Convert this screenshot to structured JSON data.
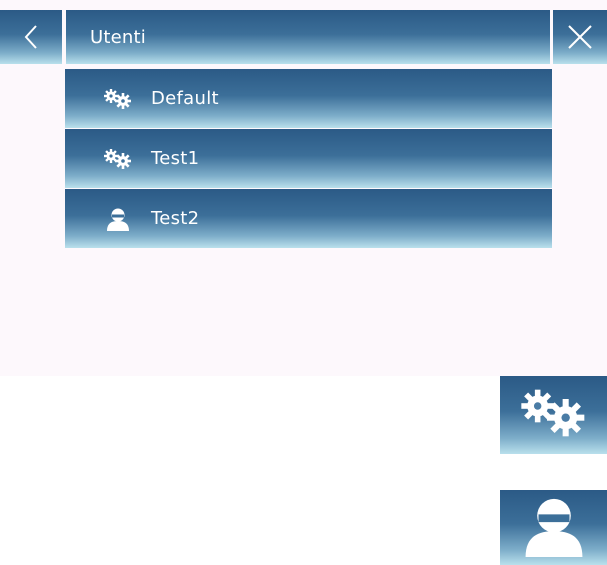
{
  "header": {
    "title": "Utenti",
    "back_icon": "chevron-left-icon",
    "close_icon": "close-icon"
  },
  "users": [
    {
      "label": "Default",
      "icon": "gears-icon"
    },
    {
      "label": "Test1",
      "icon": "gears-icon"
    },
    {
      "label": "Test2",
      "icon": "user-icon"
    }
  ],
  "side_buttons": [
    {
      "icon": "gears-icon"
    },
    {
      "icon": "user-icon"
    }
  ],
  "colors": {
    "gradient_top": "#2b5a86",
    "gradient_bottom": "#b9e0ec",
    "panel_bg": "#fdf8fc"
  }
}
